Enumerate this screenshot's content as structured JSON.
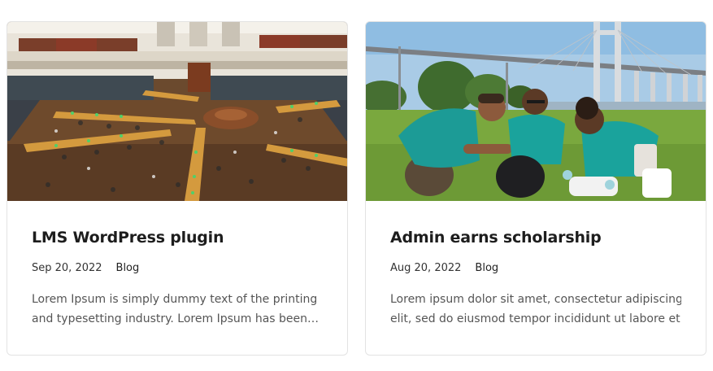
{
  "posts": [
    {
      "image_subject": "library reading room",
      "title": "LMS WordPress plugin",
      "date": "Sep 20, 2022",
      "category": "Blog",
      "excerpt_line1": "Lorem Ipsum is simply dummy text of the printing",
      "excerpt_line2": "and typesetting industry. Lorem Ipsum has been…"
    },
    {
      "image_subject": "volunteers outdoors near bridge",
      "title": "Admin earns scholarship",
      "date": "Aug 20, 2022",
      "category": "Blog",
      "excerpt_line1": "Lorem ipsum dolor sit amet, consectetur adipiscing",
      "excerpt_line2": "elit, sed do eiusmod tempor incididunt ut labore et…"
    }
  ]
}
